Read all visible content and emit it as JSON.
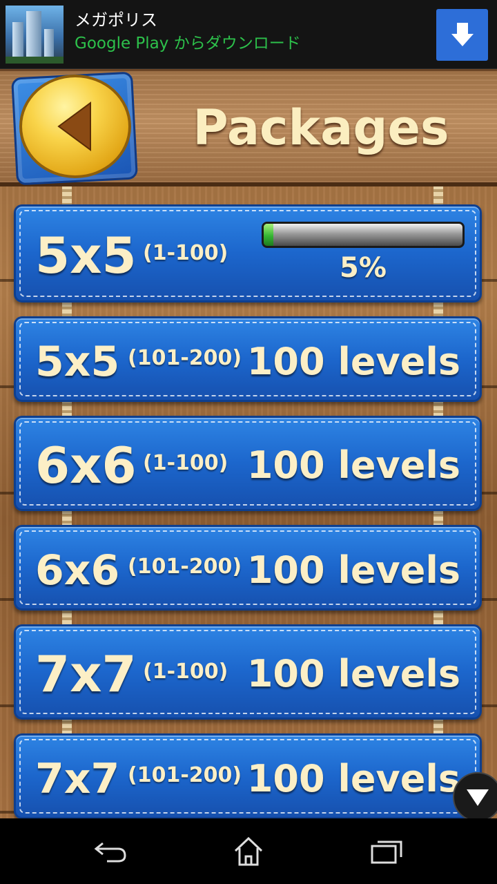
{
  "ad": {
    "title": "メガポリス",
    "subtitle": "Google Play からダウンロード",
    "download_icon": "download-arrow-icon",
    "accent_color": "#2d6ed8"
  },
  "header": {
    "title": "Packages",
    "back_icon": "back-arrow-icon"
  },
  "packages": [
    {
      "size": "5x5",
      "range": "(1-100)",
      "progress_text": "5%",
      "progress": 0.05
    },
    {
      "size": "5x5",
      "range": "(101-200)",
      "levels": "100 levels"
    },
    {
      "size": "6x6",
      "range": "(1-100)",
      "levels": "100 levels"
    },
    {
      "size": "6x6",
      "range": "(101-200)",
      "levels": "100 levels"
    },
    {
      "size": "7x7",
      "range": "(1-100)",
      "levels": "100 levels"
    },
    {
      "size": "7x7",
      "range": "(101-200)",
      "levels": "100 levels"
    }
  ],
  "scroll": {
    "icon": "scroll-down-icon"
  },
  "navbar": {
    "back_icon": "nav-back-icon",
    "home_icon": "nav-home-icon",
    "recents_icon": "nav-recents-icon"
  }
}
